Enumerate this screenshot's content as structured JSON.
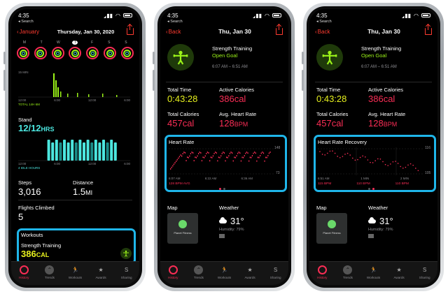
{
  "status": {
    "time": "4:35",
    "search_back": "◂ Search"
  },
  "phone1": {
    "nav": {
      "back_label": "January",
      "title": "Thursday, Jan 30, 2020"
    },
    "day_letters": [
      "M",
      "T",
      "W",
      "T",
      "F",
      "S",
      "S"
    ],
    "hourly": {
      "top_label": "15 MIN",
      "axis": [
        "12:00",
        "6:00",
        "12:00",
        "6:00"
      ],
      "total": "TOTAL 14H 6M"
    },
    "stand": {
      "title": "Stand",
      "value": "12/12",
      "unit": "HRS",
      "axis": [
        "12:00",
        "6:00",
        "12:00",
        "6:00"
      ],
      "idle": "4 IDLE HOURS"
    },
    "steps": {
      "label": "Steps",
      "value": "3,016"
    },
    "distance": {
      "label": "Distance",
      "value": "1.5",
      "unit": "MI"
    },
    "flights": {
      "label": "Flights Climbed",
      "value": "5"
    },
    "workouts": {
      "title": "Workouts",
      "name": "Strength Training",
      "value": "386",
      "unit": "CAL"
    }
  },
  "phone2": {
    "nav": {
      "back_label": "Back",
      "title": "Thu, Jan 30"
    },
    "workout": {
      "name": "Strength Training",
      "goal": "Open Goal",
      "time_range": "6:07 AM – 6:51 AM"
    },
    "total_time": {
      "label": "Total Time",
      "value": "0:43:28"
    },
    "active_cal": {
      "label": "Active Calories",
      "value": "386",
      "unit": "cal"
    },
    "total_cal": {
      "label": "Total Calories",
      "value": "457",
      "unit": "cal"
    },
    "avg_hr": {
      "label": "Avg. Heart Rate",
      "value": "128",
      "unit": "BPM"
    },
    "heart_rate": {
      "title": "Heart Rate",
      "max": "148",
      "min": "73",
      "axis": [
        "6:07 AM",
        "6:22 AM",
        "6:36 AM"
      ],
      "avg": "128 BPM AVG"
    },
    "map": {
      "label": "Map",
      "place": "Planet Fitness"
    },
    "weather": {
      "label": "Weather",
      "temp": "31°",
      "humidity": "Humidity: 79%"
    }
  },
  "phone3": {
    "nav": {
      "back_label": "Back",
      "title": "Thu, Jan 30"
    },
    "workout": {
      "name": "Strength Training",
      "goal": "Open Goal",
      "time_range": "6:07 AM – 6:51 AM"
    },
    "total_time": {
      "label": "Total Time",
      "value": "0:43:28"
    },
    "active_cal": {
      "label": "Active Calories",
      "value": "386",
      "unit": "cal"
    },
    "total_cal": {
      "label": "Total Calories",
      "value": "457",
      "unit": "cal"
    },
    "avg_hr": {
      "label": "Avg. Heart Rate",
      "value": "128",
      "unit": "BPM"
    },
    "recovery": {
      "title": "Heart Rate Recovery",
      "max": "116",
      "min": "105",
      "axis": [
        "6:51 AM",
        "1 MIN",
        "2 MIN"
      ],
      "values": [
        "115 BPM",
        "110 BPM",
        "110 BPM"
      ]
    },
    "map": {
      "label": "Map",
      "place": "Planet Fitness"
    },
    "weather": {
      "label": "Weather",
      "temp": "31°",
      "humidity": "Humidity: 79%"
    }
  },
  "tabs": [
    "History",
    "Trends",
    "Workouts",
    "Awards",
    "Sharing"
  ]
}
